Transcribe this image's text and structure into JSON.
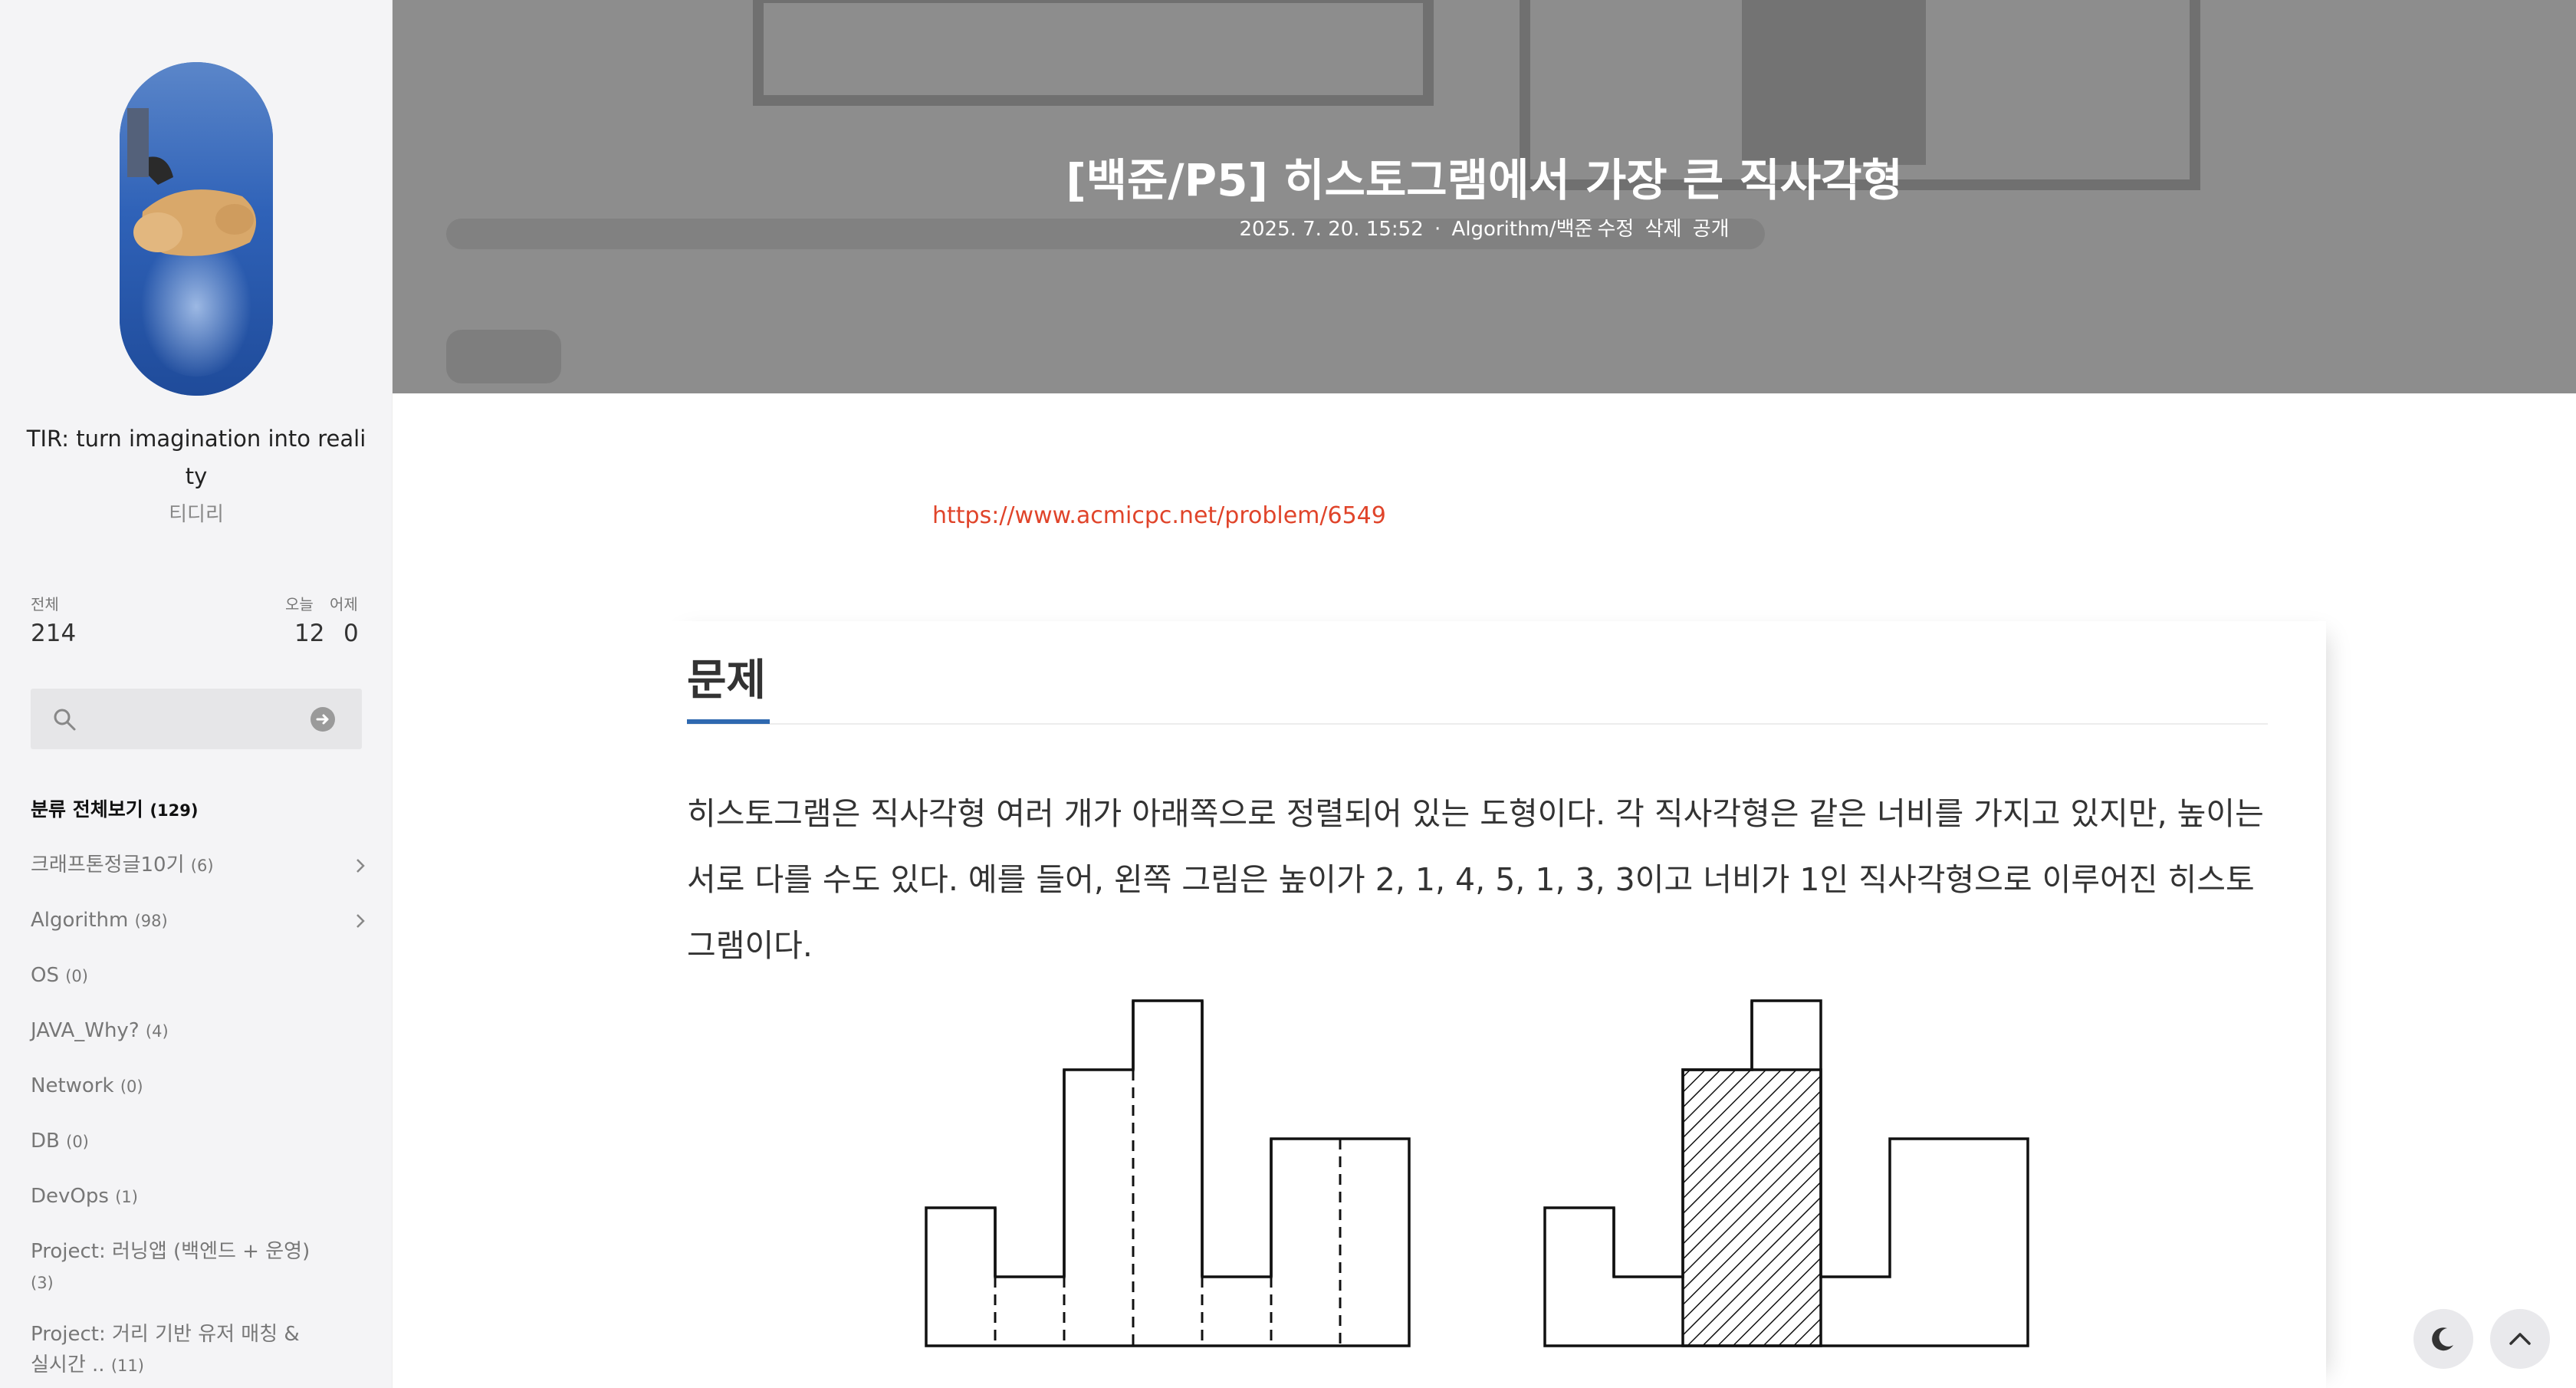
{
  "sidebar": {
    "blog_title": "TIR: turn imagination into reality",
    "blog_subtitle": "티디리",
    "stats": {
      "total_label": "전체",
      "total_value": "214",
      "today_label": "오늘",
      "today_value": "12",
      "yesterday_label": "어제",
      "yesterday_value": "0"
    },
    "search_placeholder": "",
    "category_all": {
      "label": "분류 전체보기",
      "count": "(129)"
    },
    "categories": [
      {
        "label": "크래프톤정글10기",
        "count": "(6)"
      },
      {
        "label": "Algorithm",
        "count": "(98)"
      },
      {
        "label": "OS",
        "count": "(0)"
      },
      {
        "label": "JAVA_Why?",
        "count": "(4)"
      },
      {
        "label": "Network",
        "count": "(0)"
      },
      {
        "label": "DB",
        "count": "(0)"
      },
      {
        "label": "DevOps",
        "count": "(1)"
      },
      {
        "label": "Project: 러닝앱 (백엔드 + 운영)",
        "count": "(3)"
      },
      {
        "label": "Project: 거리 기반 유저 매칭 & 실시간 ..",
        "count": "(11)"
      }
    ]
  },
  "header": {
    "title": "[백준/P5] 히스토그램에서 가장 큰 직사각형",
    "date": "2025. 7. 20. 15:52",
    "separator": "·",
    "category": "Algorithm/백준",
    "actions": [
      "수정",
      "삭제",
      "공개"
    ]
  },
  "content": {
    "source_link": "https://www.acmicpc.net/problem/6549",
    "section_title": "문제",
    "problem_text": "히스토그램은 직사각형 여러 개가 아래쪽으로 정렬되어 있는 도형이다. 각 직사각형은 같은 너비를 가지고 있지만, 높이는 서로 다를 수도 있다. 예를 들어, 왼쪽 그림은 높이가 2, 1, 4, 5, 1, 3, 3이고 너비가 1인 직사각형으로 이루어진 히스토그램이다."
  },
  "figure": {
    "left_heights": [
      2,
      1,
      4,
      5,
      1,
      3,
      3
    ],
    "right_heights": [
      2,
      1,
      4,
      5,
      1,
      3,
      3
    ],
    "highlight_range": [
      2,
      3
    ],
    "highlight_height": 4
  },
  "float_buttons": {
    "dark_mode_icon": "moon-icon",
    "top_icon": "chevron-up-icon"
  }
}
